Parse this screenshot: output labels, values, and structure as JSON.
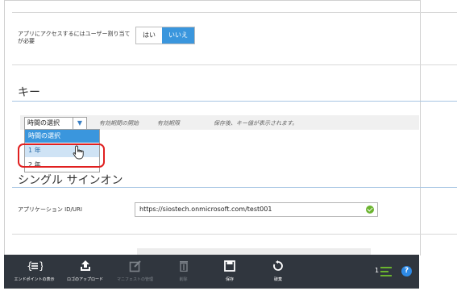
{
  "settings": {
    "user_assignment_label": "アプリにアクセスするにはユーザー割り当てが必要",
    "yes": "はい",
    "no": "いいえ"
  },
  "keys": {
    "title": "キー",
    "select_value": "時間の選択",
    "col_start": "有効期間の開始",
    "col_expire": "有効期限",
    "col_value": "保存後、キー値が表示されます。",
    "options": [
      "時間の選択",
      "1 年",
      "2 年"
    ]
  },
  "sso": {
    "title": "シングル サインオン",
    "app_id_label": "アプリケーション ID/URI",
    "app_id_value": "https://siostech.onmicrosoft.com/test001"
  },
  "commands": {
    "endpoints": "エンドポイントの表示",
    "upload_logo": "ロゴのアップロード",
    "manage_manifest": "マニフェストの管理",
    "delete": "削除",
    "save": "保存",
    "discard": "破棄",
    "count": "1"
  },
  "colors": {
    "accent": "#3a96dd",
    "bar": "#30363e",
    "highlight": "#e02020",
    "ok": "#6bb42f"
  }
}
